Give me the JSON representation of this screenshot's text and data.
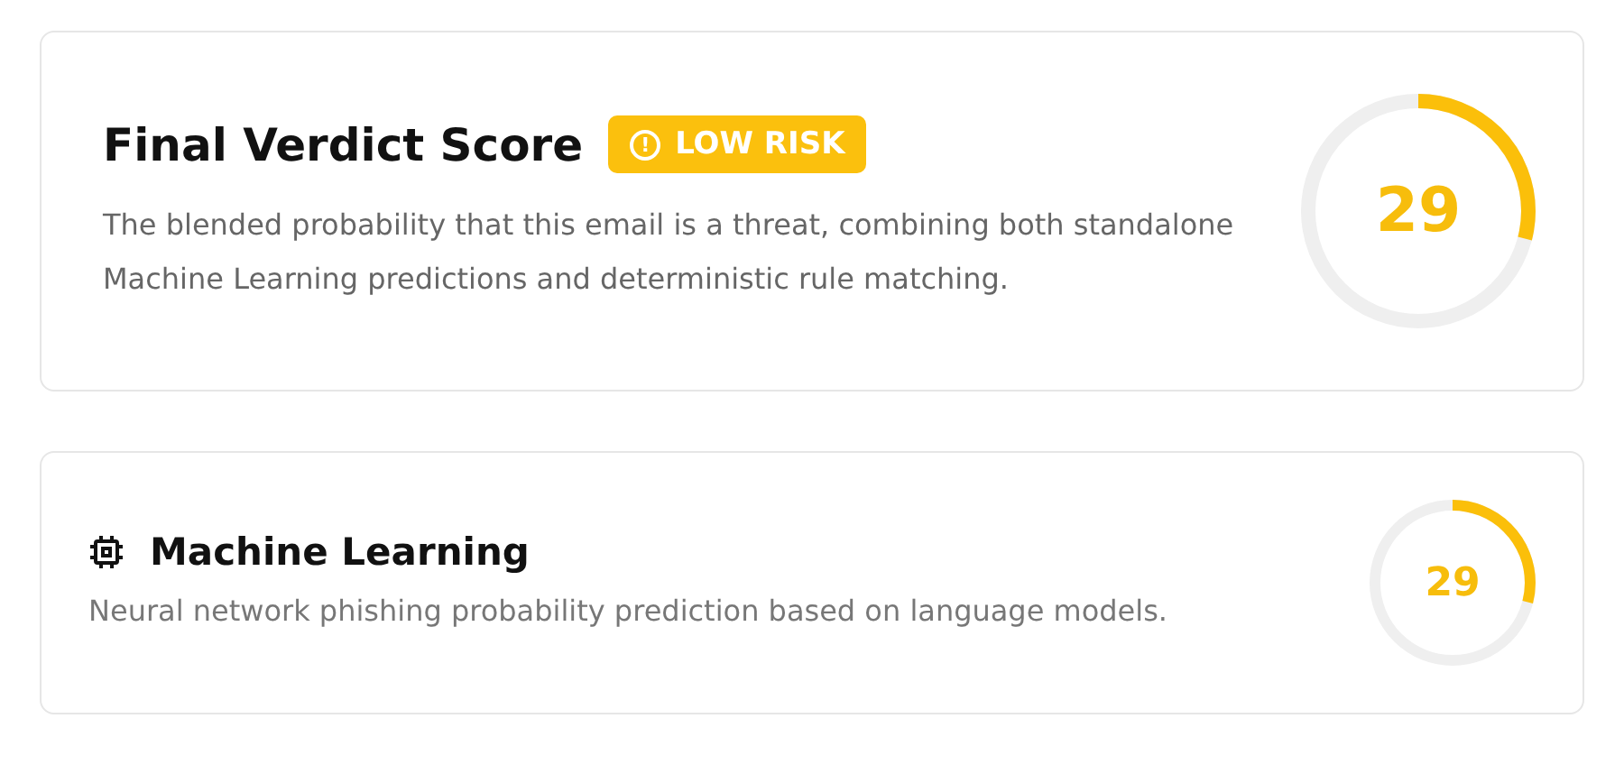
{
  "verdict": {
    "title": "Final Verdict Score",
    "badge": {
      "icon": "!",
      "label": "LOW RISK"
    },
    "description": "The blended probability that this email is a threat, combining both standalone Machine Learning predictions and deterministic rule matching.",
    "score": {
      "value": "29",
      "level": 0.29
    }
  },
  "engines": [
    {
      "kind": "ml",
      "title": "Machine Learning",
      "description": "Neural network phishing probability prediction based on language models.",
      "score": {
        "value": "29",
        "level": 0.29
      }
    }
  ]
}
